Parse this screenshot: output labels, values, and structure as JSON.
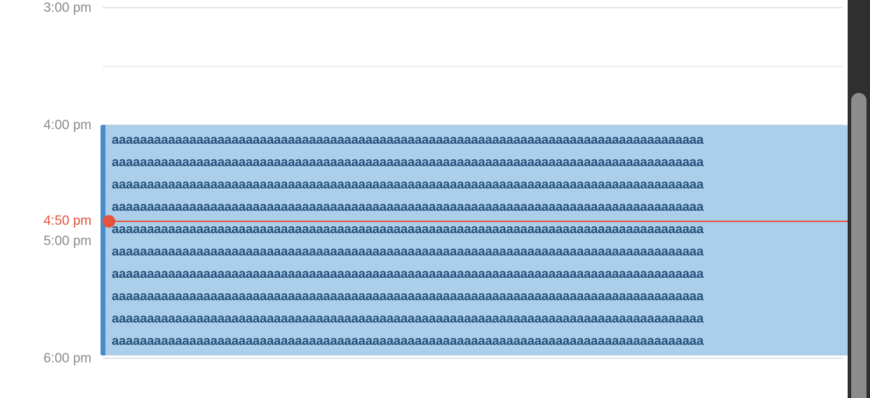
{
  "time_labels": {
    "t1500": "3:00 pm",
    "t1600": "4:00 pm",
    "t1700": "5:00 pm",
    "t1800": "6:00 pm"
  },
  "current_time": {
    "label": "4:50 pm",
    "color": "#e5533d"
  },
  "event": {
    "lines": [
      "aaaaaaaaaaaaaaaaaaaaaaaaaaaaaaaaaaaaaaaaaaaaaaaaaaaaaaaaaaaaaaaaaaaaaaaaaaaaaaaaaaaa",
      "aaaaaaaaaaaaaaaaaaaaaaaaaaaaaaaaaaaaaaaaaaaaaaaaaaaaaaaaaaaaaaaaaaaaaaaaaaaaaaaaaaaa",
      "aaaaaaaaaaaaaaaaaaaaaaaaaaaaaaaaaaaaaaaaaaaaaaaaaaaaaaaaaaaaaaaaaaaaaaaaaaaaaaaaaaaa",
      "aaaaaaaaaaaaaaaaaaaaaaaaaaaaaaaaaaaaaaaaaaaaaaaaaaaaaaaaaaaaaaaaaaaaaaaaaaaaaaaaaaaa",
      "aaaaaaaaaaaaaaaaaaaaaaaaaaaaaaaaaaaaaaaaaaaaaaaaaaaaaaaaaaaaaaaaaaaaaaaaaaaaaaaaaaaa",
      "aaaaaaaaaaaaaaaaaaaaaaaaaaaaaaaaaaaaaaaaaaaaaaaaaaaaaaaaaaaaaaaaaaaaaaaaaaaaaaaaaaaa",
      "aaaaaaaaaaaaaaaaaaaaaaaaaaaaaaaaaaaaaaaaaaaaaaaaaaaaaaaaaaaaaaaaaaaaaaaaaaaaaaaaaaaa",
      "aaaaaaaaaaaaaaaaaaaaaaaaaaaaaaaaaaaaaaaaaaaaaaaaaaaaaaaaaaaaaaaaaaaaaaaaaaaaaaaaaaaa",
      "aaaaaaaaaaaaaaaaaaaaaaaaaaaaaaaaaaaaaaaaaaaaaaaaaaaaaaaaaaaaaaaaaaaaaaaaaaaaaaaaaaaa",
      "aaaaaaaaaaaaaaaaaaaaaaaaaaaaaaaaaaaaaaaaaaaaaaaaaaaaaaaaaaaaaaaaaaaaaaaaaaaaaaaaaaaa"
    ],
    "fill_color": "#abcfea",
    "accent_color": "#4a8cc8",
    "text_color": "#24507a"
  }
}
